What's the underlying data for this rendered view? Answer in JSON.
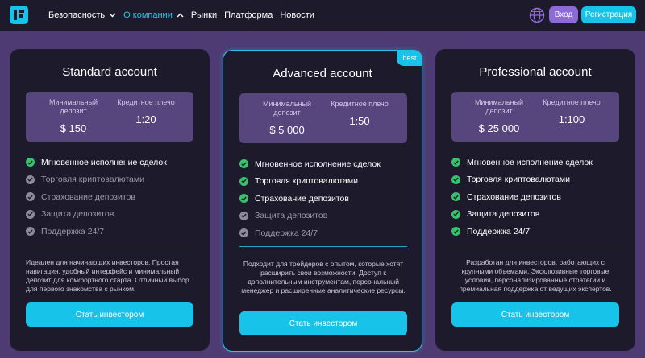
{
  "header": {
    "nav": [
      {
        "label": "Безопасность",
        "has_chevron": true,
        "active": false
      },
      {
        "label": "О компании",
        "has_chevron": true,
        "active": true
      },
      {
        "label": "Рынки",
        "has_chevron": false,
        "active": false
      },
      {
        "label": "Платформа",
        "has_chevron": false,
        "active": false
      },
      {
        "label": "Новости",
        "has_chevron": false,
        "active": false
      }
    ],
    "login_label": "Вход",
    "register_label": "Регистрация"
  },
  "colors": {
    "accent": "#17c3e8",
    "login_button": "#8c6bd6",
    "page_bg": "#4e3b73",
    "card_bg": "#1d1a2b",
    "check_enabled": "#35c46c",
    "check_disabled": "#8e8a9a"
  },
  "plans": [
    {
      "title": "Standard account",
      "deposit_label": "Минимальный депозит",
      "deposit_value": "$ 150",
      "leverage_label": "Кредитное плечо",
      "leverage_value": "1:20",
      "features": [
        {
          "label": "Мгновенное исполнение сделок",
          "enabled": true
        },
        {
          "label": "Торговля криптовалютами",
          "enabled": false
        },
        {
          "label": "Страхование депозитов",
          "enabled": false
        },
        {
          "label": "Защита депозитов",
          "enabled": false
        },
        {
          "label": "Поддержка 24/7",
          "enabled": false
        }
      ],
      "description": "Идеален для начинающих инвесторов. Простая навигация, удобный интерфейс и минимальный депозит для комфортного старта. Отличный выбор для первого знакомства с рынком.",
      "cta": "Стать инвестором"
    },
    {
      "title": "Advanced account",
      "badge": "best",
      "deposit_label": "Минимальный депозит",
      "deposit_value": "$ 5 000",
      "leverage_label": "Кредитное плечо",
      "leverage_value": "1:50",
      "features": [
        {
          "label": "Мгновенное исполнение сделок",
          "enabled": true
        },
        {
          "label": "Торговля криптовалютами",
          "enabled": true
        },
        {
          "label": "Страхование депозитов",
          "enabled": true
        },
        {
          "label": "Защита депозитов",
          "enabled": false
        },
        {
          "label": "Поддержка 24/7",
          "enabled": false
        }
      ],
      "description": "Подходит для трейдеров с опытом, которые хотят расширить свои возможности. Доступ к дополнительным инструментам, персональный менеджер и расширенные аналитические ресурсы.",
      "cta": "Стать инвестором"
    },
    {
      "title": "Professional account",
      "deposit_label": "Минимальный депозит",
      "deposit_value": "$ 25 000",
      "leverage_label": "Кредитное плечо",
      "leverage_value": "1:100",
      "features": [
        {
          "label": "Мгновенное исполнение сделок",
          "enabled": true
        },
        {
          "label": "Торговля криптовалютами",
          "enabled": true
        },
        {
          "label": "Страхование депозитов",
          "enabled": true
        },
        {
          "label": "Защита депозитов",
          "enabled": true
        },
        {
          "label": "Поддержка 24/7",
          "enabled": true
        }
      ],
      "description": "Разработан для инвесторов, работающих с крупными объемами. Эксклюзивные торговые условия, персонализированные стратегии и премиальная поддержка от ведущих экспертов.",
      "cta": "Стать инвестором"
    }
  ]
}
